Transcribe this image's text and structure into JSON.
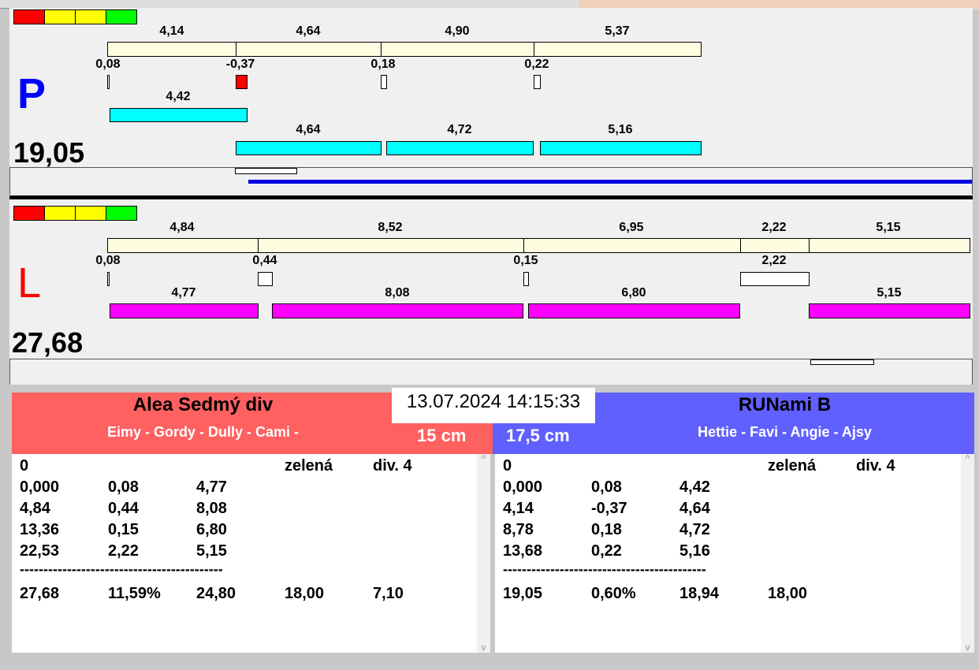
{
  "tabs_strip": "",
  "colors": {
    "red": "#ff0000",
    "yellow": "#ffff00",
    "green": "#00ff00",
    "p_color": "#0000ff",
    "l_color": "#ff0000",
    "left_header": "#ff6060",
    "right_header": "#6060ff"
  },
  "P": {
    "letter": "P",
    "total": "19,05",
    "top": [
      "4,14",
      "4,64",
      "4,90",
      "5,37"
    ],
    "diff": [
      "0,08",
      "-0,37",
      "0,18",
      "0,22"
    ],
    "row1": [
      "4,42"
    ],
    "row2": [
      "4,64",
      "4,72",
      "5,16"
    ]
  },
  "L": {
    "letter": "L",
    "total": "27,68",
    "top": [
      "4,84",
      "8,52",
      "6,95",
      "2,22",
      "5,15"
    ],
    "diff": [
      "0,08",
      "0,44",
      "0,15",
      "2,22"
    ],
    "row": [
      "4,77",
      "8,08",
      "6,80",
      "5,15"
    ]
  },
  "datetime": "13.07.2024 14:15:33",
  "left": {
    "team": "Alea Sedmý div",
    "dogs": "Eimy - Gordy - Dully - Cami -",
    "height": "15 cm",
    "header": [
      "0",
      "",
      "",
      "zelená",
      "div. 4"
    ],
    "rows": [
      [
        "0,000",
        "0,08",
        "4,77"
      ],
      [
        "4,84",
        "0,44",
        "8,08"
      ],
      [
        "13,36",
        "0,15",
        "6,80"
      ],
      [
        "22,53",
        "2,22",
        "5,15"
      ]
    ],
    "sep": "-------------------------------------------",
    "summary": [
      "27,68",
      "11,59%",
      "24,80",
      "18,00",
      "7,10"
    ]
  },
  "right": {
    "team": "RUNami B",
    "dogs": "Hettie - Favi - Angie - Ajsy",
    "height": "17,5 cm",
    "header": [
      "0",
      "",
      "",
      "zelená",
      "div. 4"
    ],
    "rows": [
      [
        "0,000",
        "0,08",
        "4,42"
      ],
      [
        "4,14",
        "-0,37",
        "4,64"
      ],
      [
        "8,78",
        "0,18",
        "4,72"
      ],
      [
        "13,68",
        "0,22",
        "5,16"
      ]
    ],
    "sep": "-------------------------------------------",
    "summary": [
      "19,05",
      "0,60%",
      "18,94",
      "18,00"
    ]
  }
}
